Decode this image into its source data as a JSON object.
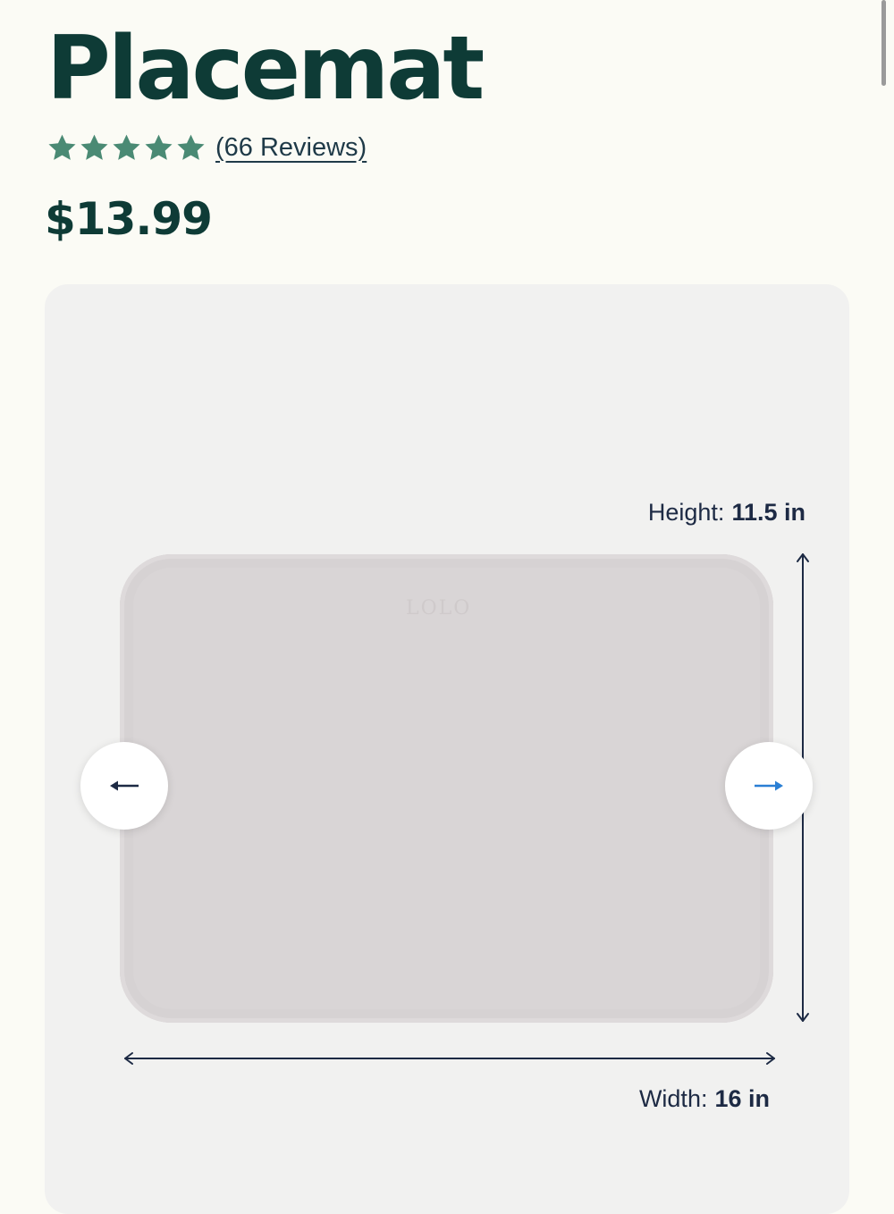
{
  "product": {
    "title": "Placemat",
    "rating": {
      "stars": 5,
      "max_stars": 5,
      "reviews_label": "(66 Reviews)"
    },
    "price": "$13.99"
  },
  "gallery": {
    "mat_logo": "LOLO",
    "dimensions": {
      "height_label": "Height:",
      "height_value": "11.5 in",
      "width_label": "Width:",
      "width_value": "16 in"
    },
    "nav": {
      "prev_icon": "arrow-left-icon",
      "next_icon": "arrow-right-icon"
    }
  },
  "colors": {
    "title": "#0e3b36",
    "star": "#4a8a74",
    "dimension_lines": "#1d2a44",
    "next_arrow": "#2a7fd4",
    "background": "#fbfbf5",
    "gallery_bg": "#f1f1f0"
  }
}
